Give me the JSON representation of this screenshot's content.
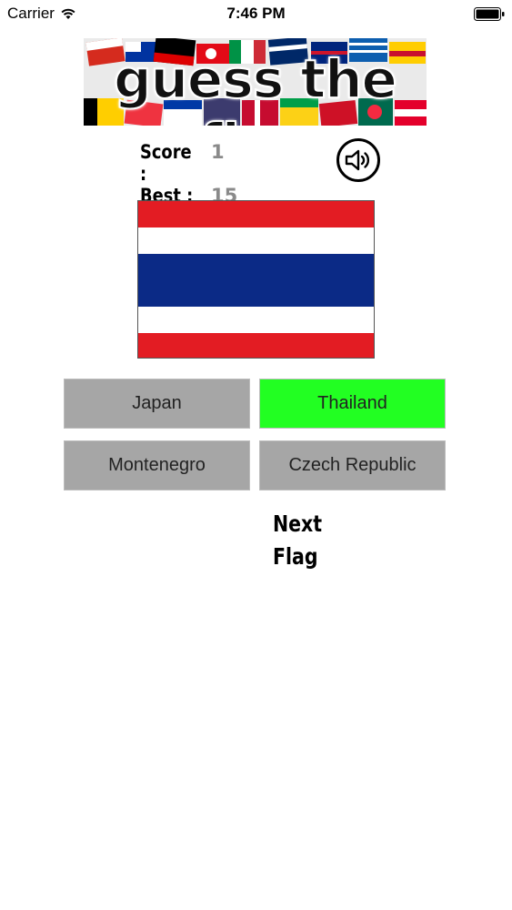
{
  "status_bar": {
    "carrier": "Carrier",
    "time": "7:46 PM"
  },
  "banner": {
    "title": "guess the flag"
  },
  "score": {
    "score_label": "Score :",
    "score_value": "1",
    "best_label": "Best  :",
    "best_value": "15"
  },
  "flag": {
    "country": "Thailand",
    "stripes": [
      "#e31c23",
      "#ffffff",
      "#0b2a86",
      "#ffffff",
      "#e31c23"
    ]
  },
  "answers": [
    {
      "label": "Japan",
      "state": "neutral"
    },
    {
      "label": "Thailand",
      "state": "correct"
    },
    {
      "label": "Montenegro",
      "state": "neutral"
    },
    {
      "label": "Czech Republic",
      "state": "neutral"
    }
  ],
  "next_button": {
    "label": "Next Flag"
  },
  "colors": {
    "correct": "#22ff22",
    "neutral": "#a6a6a6",
    "score_value": "#8a8a8a"
  },
  "icons": {
    "sound": "speaker-icon",
    "wifi": "wifi-icon",
    "battery": "battery-icon"
  }
}
